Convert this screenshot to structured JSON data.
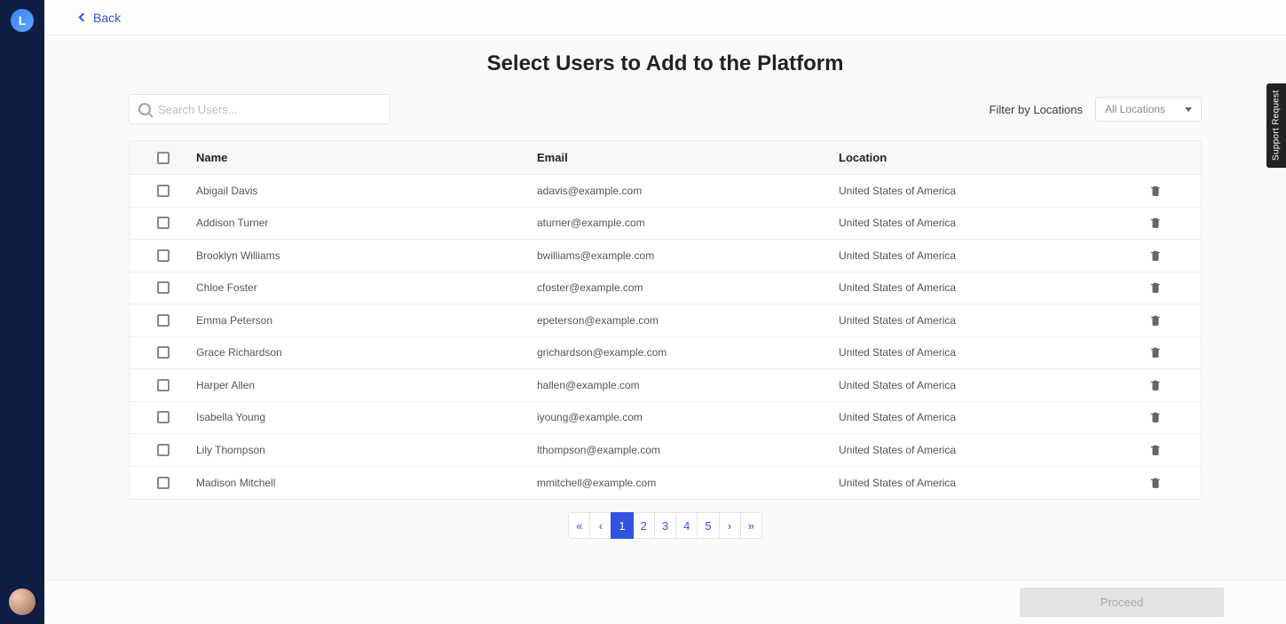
{
  "sidebar": {
    "logo_letter": "L"
  },
  "topbar": {
    "back_label": "Back"
  },
  "page": {
    "title": "Select Users to Add to the Platform"
  },
  "search": {
    "placeholder": "Search Users..."
  },
  "filter": {
    "label": "Filter by Locations",
    "selected": "All Locations"
  },
  "columns": {
    "name": "Name",
    "email": "Email",
    "location": "Location"
  },
  "rows": [
    {
      "name": "Abigail Davis",
      "email": "adavis@example.com",
      "location": "United States of America"
    },
    {
      "name": "Addison Turner",
      "email": "aturner@example.com",
      "location": "United States of America"
    },
    {
      "name": "Brooklyn Williams",
      "email": "bwilliams@example.com",
      "location": "United States of America"
    },
    {
      "name": "Chloe Foster",
      "email": "cfoster@example.com",
      "location": "United States of America"
    },
    {
      "name": "Emma Peterson",
      "email": "epeterson@example.com",
      "location": "United States of America"
    },
    {
      "name": "Grace Richardson",
      "email": "grichardson@example.com",
      "location": "United States of America"
    },
    {
      "name": "Harper Allen",
      "email": "hallen@example.com",
      "location": "United States of America"
    },
    {
      "name": "Isabella Young",
      "email": "iyoung@example.com",
      "location": "United States of America"
    },
    {
      "name": "Lily Thompson",
      "email": "lthompson@example.com",
      "location": "United States of America"
    },
    {
      "name": "Madison Mitchell",
      "email": "mmitchell@example.com",
      "location": "United States of America"
    }
  ],
  "pagination": {
    "first": "«",
    "prev": "‹",
    "pages": [
      "1",
      "2",
      "3",
      "4",
      "5"
    ],
    "active_index": 0,
    "next": "›",
    "last": "»"
  },
  "footer": {
    "proceed": "Proceed"
  },
  "support": {
    "label": "Support Request"
  }
}
